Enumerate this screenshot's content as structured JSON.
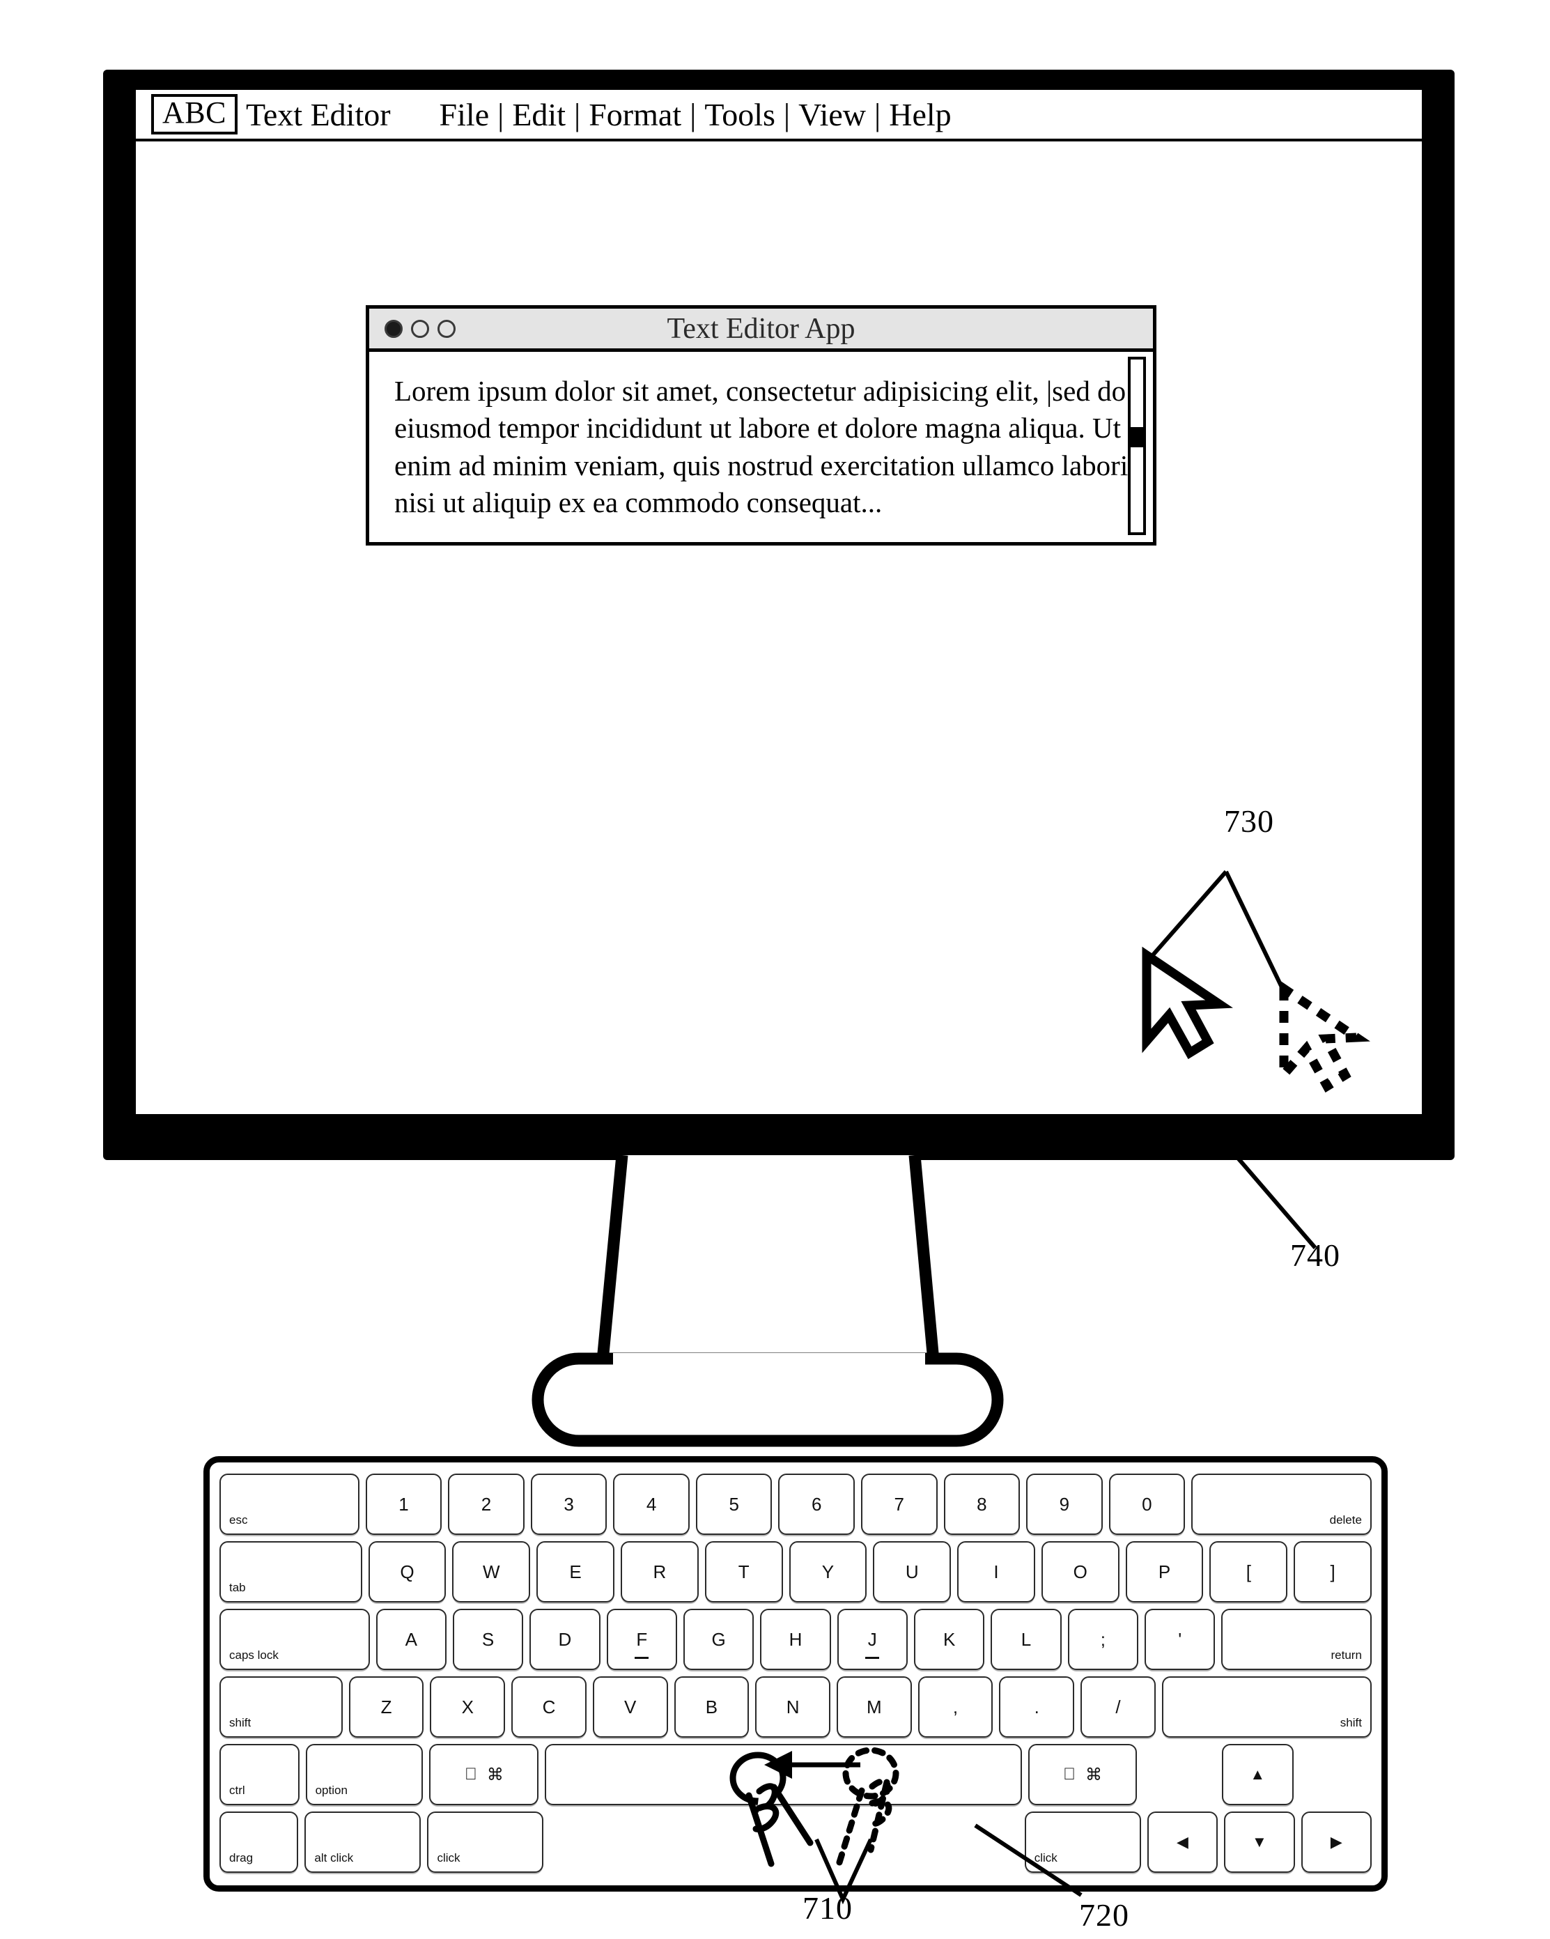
{
  "figure": {
    "reference_labels": [
      {
        "id": "730",
        "text": "730"
      },
      {
        "id": "740",
        "text": "740"
      },
      {
        "id": "710",
        "text": "710"
      },
      {
        "id": "720",
        "text": "720"
      }
    ]
  },
  "menubar": {
    "badge": "ABC",
    "app_name": "Text Editor",
    "items": [
      "File",
      "Edit",
      "Format",
      "Tools",
      "View",
      "Help"
    ],
    "separator": "|"
  },
  "app_window": {
    "title": "Text Editor App",
    "traffic_lights": [
      "close",
      "minimize",
      "zoom"
    ],
    "document_text": "Lorem ipsum dolor sit amet, consectetur adipisicing elit, |sed do eiusmod tempor incididunt ut labore et dolore magna aliqua. Ut enim ad minim veniam, quis nostrud exercitation ullamco laboris nisi ut aliquip ex ea commodo consequat...",
    "scrollbar": {
      "thumb_position_pct": 39,
      "thumb_size_pct": 12
    }
  },
  "keyboard": {
    "rows": [
      {
        "name": "number-row",
        "keys": [
          {
            "label": "esc",
            "style": "small",
            "width": "w17"
          },
          {
            "label": "1"
          },
          {
            "label": "2"
          },
          {
            "label": "3"
          },
          {
            "label": "4"
          },
          {
            "label": "5"
          },
          {
            "label": "6"
          },
          {
            "label": "7"
          },
          {
            "label": "8"
          },
          {
            "label": "9"
          },
          {
            "label": "0"
          },
          {
            "label": "delete",
            "style": "small-right",
            "width": "w22"
          }
        ]
      },
      {
        "name": "qwerty-row",
        "keys": [
          {
            "label": "tab",
            "style": "small",
            "width": "w17"
          },
          {
            "label": "Q"
          },
          {
            "label": "W"
          },
          {
            "label": "E"
          },
          {
            "label": "R"
          },
          {
            "label": "T"
          },
          {
            "label": "Y"
          },
          {
            "label": "U"
          },
          {
            "label": "I"
          },
          {
            "label": "O"
          },
          {
            "label": "P"
          },
          {
            "label": "["
          },
          {
            "label": "]"
          }
        ]
      },
      {
        "name": "home-row",
        "keys": [
          {
            "label": "caps lock",
            "style": "small",
            "width": "w20"
          },
          {
            "label": "A"
          },
          {
            "label": "S"
          },
          {
            "label": "D"
          },
          {
            "label": "F",
            "home": true
          },
          {
            "label": "G"
          },
          {
            "label": "H"
          },
          {
            "label": "J",
            "home": true
          },
          {
            "label": "K"
          },
          {
            "label": "L"
          },
          {
            "label": ";"
          },
          {
            "label": "'"
          },
          {
            "label": "return",
            "style": "small-right",
            "width": "w20"
          }
        ]
      },
      {
        "name": "shift-row",
        "keys": [
          {
            "label": "shift",
            "style": "small",
            "width": "w15"
          },
          {
            "label": "Z"
          },
          {
            "label": "X"
          },
          {
            "label": "C"
          },
          {
            "label": "V"
          },
          {
            "label": "B"
          },
          {
            "label": "N"
          },
          {
            "label": "M"
          },
          {
            "label": ","
          },
          {
            "label": "."
          },
          {
            "label": "/"
          },
          {
            "label": "shift",
            "style": "small-right",
            "width": "w26"
          }
        ]
      },
      {
        "name": "modifier-row",
        "keys": [
          {
            "label": "ctrl",
            "style": "small"
          },
          {
            "label": "option",
            "style": "small",
            "width": "w15"
          },
          {
            "label": "cmd",
            "icon": "apple-command",
            "width": "w15"
          },
          {
            "label": "",
            "name": "spacebar",
            "width": "w65"
          },
          {
            "label": "cmd",
            "icon": "apple-command",
            "width": "w15"
          },
          {
            "label": "",
            "name": "gap"
          },
          {
            "label": "▲",
            "name": "arrow-up"
          },
          {
            "label": "",
            "name": "gap"
          }
        ]
      },
      {
        "name": "action-row",
        "keys": [
          {
            "label": "drag",
            "style": "small"
          },
          {
            "label": "alt click",
            "style": "small",
            "width": "w15"
          },
          {
            "label": "click",
            "style": "small",
            "width": "w15"
          },
          {
            "label": "",
            "name": "gap-wide",
            "width": "w65"
          },
          {
            "label": "click",
            "style": "small",
            "width": "w15"
          },
          {
            "label": "◀",
            "name": "arrow-left"
          },
          {
            "label": "▼",
            "name": "arrow-down"
          },
          {
            "label": "▶",
            "name": "arrow-right"
          }
        ]
      }
    ],
    "symbols": {
      "apple": "⌘",
      "command": "⌘"
    }
  }
}
